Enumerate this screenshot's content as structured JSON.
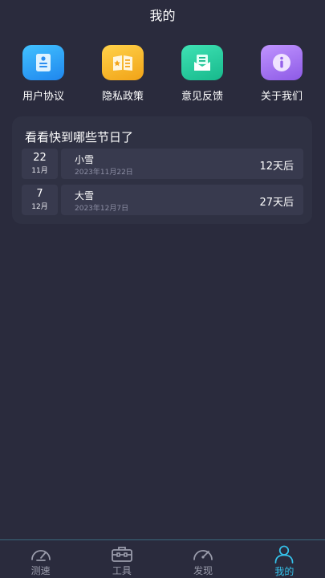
{
  "header": {
    "title": "我的"
  },
  "quick_actions": [
    {
      "label": "用户协议",
      "icon": "document-icon",
      "color": "#2aa4f5"
    },
    {
      "label": "隐私政策",
      "icon": "book-icon",
      "color": "#f6b626"
    },
    {
      "label": "意见反馈",
      "icon": "message-icon",
      "color": "#1fc89c"
    },
    {
      "label": "关于我们",
      "icon": "info-icon",
      "color": "#a774ee"
    }
  ],
  "festival_card": {
    "title": "看看快到哪些节日了",
    "items": [
      {
        "day": "22",
        "month": "11月",
        "name": "小雪",
        "date": "2023年11月22日",
        "countdown": "12天后"
      },
      {
        "day": "7",
        "month": "12月",
        "name": "大雪",
        "date": "2023年12月7日",
        "countdown": "27天后"
      }
    ]
  },
  "tabbar": {
    "active_color": "#35c3ec",
    "tabs": [
      {
        "label": "测速",
        "icon": "speedometer-icon"
      },
      {
        "label": "工具",
        "icon": "toolbox-icon"
      },
      {
        "label": "发现",
        "icon": "compass-gauge-icon"
      },
      {
        "label": "我的",
        "icon": "person-icon",
        "active": true
      }
    ]
  }
}
